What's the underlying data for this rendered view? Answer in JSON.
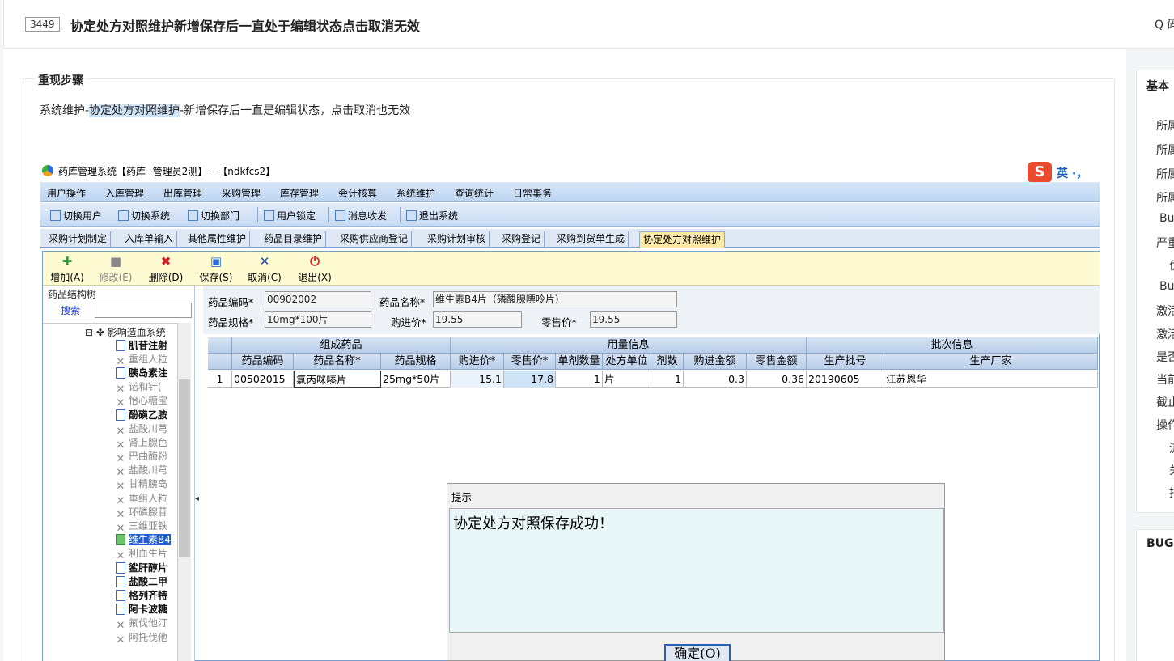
{
  "header": {
    "bug_id": "3449",
    "title": "协定处方对照维护新增保存后一直处于编辑状态点击取消无效",
    "search_label": "Q 码"
  },
  "steps": {
    "section_title": "重现步骤",
    "text_prefix": "系统维护-",
    "text_highlight": "协定处方对照维护",
    "text_suffix": "-新增保存后一直是编辑状态，点击取消也无效"
  },
  "right_panel": {
    "title": "基本",
    "items": [
      "所属",
      "所属",
      "所属",
      "所属",
      "Bu",
      "严重",
      "优",
      "Bu",
      "激活",
      "激活",
      "是否",
      "当前",
      "截止",
      "操作",
      "流",
      "关",
      "指"
    ],
    "bug_title": "BUG"
  },
  "app": {
    "window_title": "药库管理系统【药库--管理员2测】---【ndkfcs2】",
    "ime_label": "英 ·，",
    "menu": [
      "用户操作",
      "入库管理",
      "出库管理",
      "采购管理",
      "库存管理",
      "会计核算",
      "系统维护",
      "查询统计",
      "日常事务"
    ],
    "toolbar": [
      "切换用户",
      "切换系统",
      "切换部门",
      "用户锁定",
      "消息收发",
      "退出系统"
    ],
    "tabs": [
      "采购计划制定",
      "入库单输入",
      "其他属性维护",
      "药品目录维护",
      "采购供应商登记",
      "采购计划审核",
      "采购登记",
      "采购到货单生成",
      "协定处方对照维护"
    ],
    "actions": [
      "增加(A)",
      "修改(E)",
      "删除(D)",
      "保存(S)",
      "取消(C)",
      "退出(X)"
    ],
    "tree": {
      "header": "药品结构树",
      "search_label": "搜索",
      "root": "影响造血系统",
      "items": [
        "肌苷注射",
        "重组人粒",
        "胰岛素注",
        "诺和针(",
        "怡心糖宝",
        "酚磺乙胺",
        "盐酸川芎",
        "肾上腺色",
        "巴曲酶粉",
        "盐酸川芎",
        "甘精胰岛",
        "重组人粒",
        "环磷腺苷",
        "三维亚铁",
        "维生素B4",
        "利血生片",
        "鲨肝醇片",
        "盐酸二甲",
        "格列齐特",
        "阿卡波糖",
        "氟伐他汀",
        "阿托伐他"
      ]
    },
    "form": {
      "code_label": "药品编码*",
      "code_value": "00902002",
      "name_label": "药品名称*",
      "name_value": "维生素B4片（磷酸腺嘌呤片）",
      "spec_label": "药品规格*",
      "spec_value": "10mg*100片",
      "buy_label": "购进价*",
      "buy_value": "19.55",
      "retail_label": "零售价*",
      "retail_value": "19.55"
    },
    "grid": {
      "groups": [
        "组成药品",
        "用量信息",
        "批次信息"
      ],
      "columns": [
        "药品编码",
        "药品名称*",
        "药品规格",
        "购进价*",
        "零售价*",
        "单剂数量",
        "处方单位",
        "剂数",
        "购进金额",
        "零售金额",
        "生产批号",
        "生产厂家"
      ],
      "rows": [
        [
          "1",
          "00502015",
          "氯丙咪嗪片",
          "25mg*50片",
          "15.1",
          "17.8",
          "1",
          "片",
          "1",
          "0.3",
          "0.36",
          "20190605",
          "江苏恩华"
        ]
      ]
    },
    "dialog": {
      "title": "提示",
      "message": "协定处方对照保存成功！",
      "ok_label": "确定(O)"
    }
  }
}
